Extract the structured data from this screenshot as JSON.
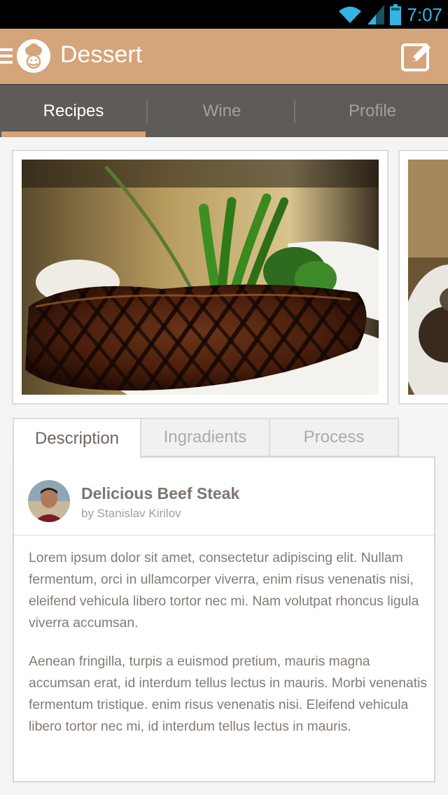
{
  "status_bar": {
    "time": "7:07",
    "icons": [
      "wifi-icon",
      "signal-icon",
      "battery-icon"
    ]
  },
  "app_bar": {
    "title": "Dessert",
    "icons": [
      "menu-icon",
      "chef-logo-icon",
      "edit-icon"
    ]
  },
  "nav_tabs": [
    {
      "label": "Recipes",
      "active": true
    },
    {
      "label": "Wine",
      "active": false
    },
    {
      "label": "Profile",
      "active": false
    }
  ],
  "carousel": {
    "images": [
      "grilled-steak-photo",
      "next-dish-photo"
    ]
  },
  "detail_tabs": [
    {
      "label": "Description",
      "active": true
    },
    {
      "label": "Ingradients",
      "active": false
    },
    {
      "label": "Process",
      "active": false
    }
  ],
  "recipe": {
    "title": "Delicious Beef Steak",
    "author": "by Stanislav Kirilov",
    "paragraphs": [
      "Lorem ipsum dolor sit amet, consectetur adipiscing elit. Nullam fermentum, orci in ullamcorper viverra, enim risus venenatis nisi, eleifend vehicula libero tortor nec mi. Nam volutpat rhoncus ligula viverra accumsan.",
      "Aenean fringilla, turpis a euismod pretium, mauris magna accumsan erat, id interdum tellus lectus in mauris. Morbi venenatis fermentum tristique. enim risus venenatis nisi. Eleifend vehicula libero tortor nec mi, id interdum tellus lectus in mauris."
    ]
  },
  "colors": {
    "accent": "#d4a47a",
    "nav_background": "#5f5b58",
    "status_time": "#33b5e5"
  }
}
